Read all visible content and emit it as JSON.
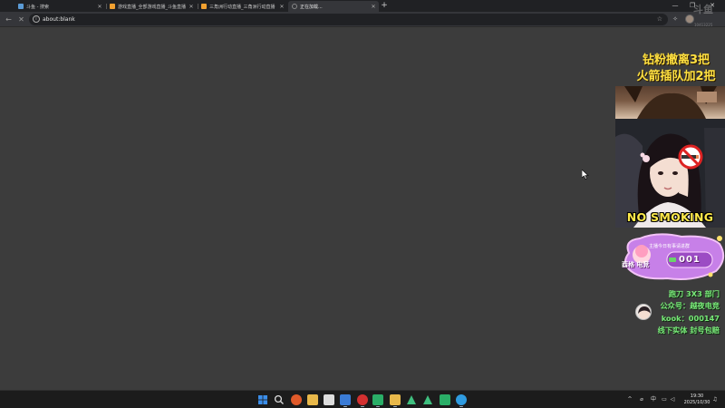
{
  "browser": {
    "tabs": [
      {
        "title": "斗鱼 - 搜索",
        "active": false,
        "favicon_color": "#5b9bd5"
      },
      {
        "title": "游戏直播_全部游戏直播_斗鱼直播",
        "active": false,
        "favicon_color": "#f0a030"
      },
      {
        "title": "三角洲行动直播_三角洲行动直播",
        "active": false,
        "favicon_color": "#f0a030"
      },
      {
        "title": "正在加载...",
        "active": true,
        "favicon_color": "#888888"
      }
    ],
    "new_tab_label": "+",
    "window_controls": {
      "minimize": "—",
      "restore": "❐",
      "close": "✕"
    },
    "address": {
      "url": "about:blank"
    },
    "nav": {
      "back": "←",
      "reload": "✕"
    }
  },
  "stream_overlay": {
    "watermark_logo": "斗鱼",
    "watermark_id": "10413225",
    "banner_line1": "钻粉撤离3把",
    "banner_line2": "火箭插队加2把",
    "no_smoking_text": "NO SMOKING",
    "badge": {
      "top_text": "主播今日有事请进群",
      "name": "酉格 电竞",
      "number": "001"
    },
    "info_lines": [
      "跑刀 3X3 部门",
      "公众号：越夜电竞",
      "kook：000147",
      "线下实体 封号包赔"
    ]
  },
  "taskbar": {
    "apps": [
      {
        "name": "start-icon",
        "color": "#3b8eea"
      },
      {
        "name": "search-icon",
        "color": "#cccccc"
      },
      {
        "name": "app-icon-1",
        "color": "#e05a2a"
      },
      {
        "name": "file-explorer-icon",
        "color": "#e8b84a"
      },
      {
        "name": "store-icon",
        "color": "#dddddd"
      },
      {
        "name": "app-icon-2",
        "color": "#e0e0e0"
      },
      {
        "name": "app-icon-3",
        "color": "#3a7bd5"
      },
      {
        "name": "app-icon-4",
        "color": "#d33030"
      },
      {
        "name": "wechat-icon",
        "color": "#2aae67"
      },
      {
        "name": "app-icon-5",
        "color": "#e8b84a"
      },
      {
        "name": "app-icon-6",
        "color": "#ffffff"
      },
      {
        "name": "app-icon-7",
        "color": "#3fbf7f"
      },
      {
        "name": "app-icon-8",
        "color": "#3fbf7f"
      },
      {
        "name": "app-icon-9",
        "color": "#2aae67"
      },
      {
        "name": "edge-icon",
        "color": "#2f9be0"
      }
    ],
    "tray": {
      "chevron": "^",
      "ime": "中",
      "clock_time": "19:30",
      "clock_date": "2025/10/30"
    }
  }
}
